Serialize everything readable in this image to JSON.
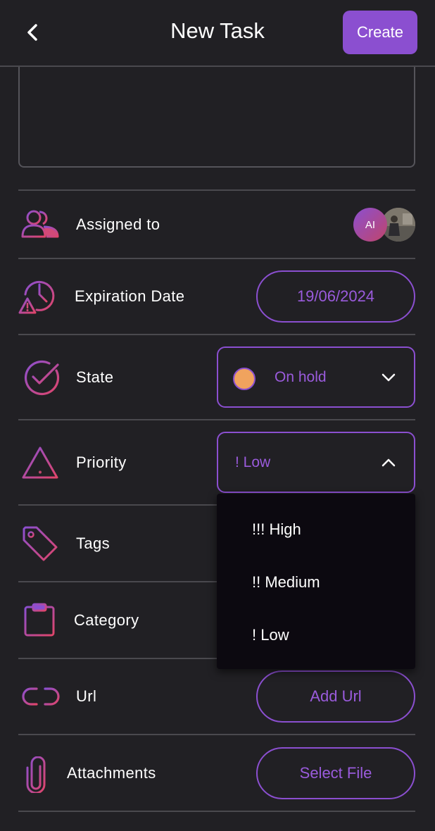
{
  "header": {
    "title": "New Task",
    "create_label": "Create"
  },
  "assigned": {
    "label": "Assigned to",
    "avatar_initials": "AI"
  },
  "expiration": {
    "label": "Expiration Date",
    "value": "19/06/2024"
  },
  "state": {
    "label": "State",
    "value": "On hold",
    "dot_color": "#f0a35e"
  },
  "priority": {
    "label": "Priority",
    "value": "! Low",
    "options": [
      "!!! High",
      "!! Medium",
      "! Low"
    ]
  },
  "tags": {
    "label": "Tags"
  },
  "category": {
    "label": "Category"
  },
  "url": {
    "label": "Url",
    "button_label": "Add Url"
  },
  "attachments": {
    "label": "Attachments",
    "button_label": "Select File"
  },
  "colors": {
    "accent": "#8b4fd0",
    "accent_text": "#9a5bdc",
    "icon_gradient_start": "#8b4fd0",
    "icon_gradient_end": "#e0456a",
    "background": "#212024"
  },
  "icons": [
    "back-icon",
    "users-icon",
    "clock-alert-icon",
    "check-circle-icon",
    "warning-icon",
    "tag-icon",
    "clipboard-icon",
    "link-icon",
    "paperclip-icon",
    "chevron-down-icon",
    "chevron-up-icon"
  ]
}
